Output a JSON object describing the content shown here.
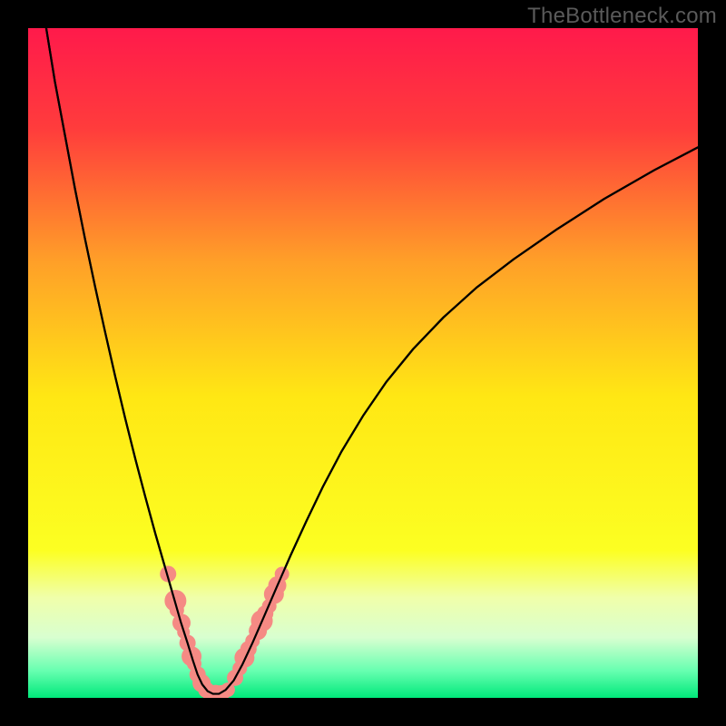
{
  "watermark": "TheBottleneck.com",
  "chart_data": {
    "type": "line",
    "title": "",
    "xlabel": "",
    "ylabel": "",
    "xlim": [
      0,
      1
    ],
    "ylim": [
      0,
      1
    ],
    "background_gradient": {
      "stops": [
        {
          "offset": 0.0,
          "color": "#ff1a4b"
        },
        {
          "offset": 0.15,
          "color": "#ff3c3c"
        },
        {
          "offset": 0.35,
          "color": "#ffa028"
        },
        {
          "offset": 0.55,
          "color": "#ffe714"
        },
        {
          "offset": 0.78,
          "color": "#fcff22"
        },
        {
          "offset": 0.85,
          "color": "#f0ffaa"
        },
        {
          "offset": 0.91,
          "color": "#d8ffd0"
        },
        {
          "offset": 0.96,
          "color": "#66ffb0"
        },
        {
          "offset": 1.0,
          "color": "#00e87a"
        }
      ]
    },
    "series": [
      {
        "name": "bottleneck-curve",
        "color": "#000000",
        "x": [
          0.027,
          0.04,
          0.055,
          0.07,
          0.085,
          0.1,
          0.115,
          0.13,
          0.145,
          0.16,
          0.175,
          0.19,
          0.205,
          0.218,
          0.228,
          0.238,
          0.246,
          0.253,
          0.26,
          0.268,
          0.276,
          0.285,
          0.295,
          0.307,
          0.32,
          0.335,
          0.352,
          0.371,
          0.392,
          0.415,
          0.44,
          0.468,
          0.5,
          0.535,
          0.575,
          0.62,
          0.67,
          0.725,
          0.79,
          0.86,
          0.935,
          1.0
        ],
        "y": [
          1.0,
          0.92,
          0.84,
          0.76,
          0.685,
          0.614,
          0.546,
          0.48,
          0.417,
          0.357,
          0.3,
          0.245,
          0.193,
          0.148,
          0.113,
          0.082,
          0.056,
          0.035,
          0.02,
          0.01,
          0.006,
          0.006,
          0.012,
          0.026,
          0.05,
          0.082,
          0.121,
          0.165,
          0.213,
          0.263,
          0.315,
          0.368,
          0.421,
          0.472,
          0.521,
          0.568,
          0.613,
          0.655,
          0.7,
          0.745,
          0.788,
          0.822
        ]
      }
    ],
    "markers": [
      {
        "name": "left-cluster",
        "color": "#f58a84",
        "points": [
          {
            "x": 0.209,
            "y": 0.185,
            "r": 9
          },
          {
            "x": 0.22,
            "y": 0.145,
            "r": 12
          },
          {
            "x": 0.222,
            "y": 0.131,
            "r": 8
          },
          {
            "x": 0.229,
            "y": 0.112,
            "r": 10
          },
          {
            "x": 0.232,
            "y": 0.098,
            "r": 7
          },
          {
            "x": 0.238,
            "y": 0.082,
            "r": 9
          },
          {
            "x": 0.244,
            "y": 0.062,
            "r": 11
          },
          {
            "x": 0.248,
            "y": 0.051,
            "r": 8
          },
          {
            "x": 0.253,
            "y": 0.035,
            "r": 9
          },
          {
            "x": 0.259,
            "y": 0.022,
            "r": 10
          },
          {
            "x": 0.266,
            "y": 0.012,
            "r": 9
          }
        ]
      },
      {
        "name": "bottom-cluster",
        "color": "#f58a84",
        "points": [
          {
            "x": 0.272,
            "y": 0.007,
            "r": 9
          },
          {
            "x": 0.28,
            "y": 0.006,
            "r": 10
          },
          {
            "x": 0.289,
            "y": 0.007,
            "r": 9
          },
          {
            "x": 0.298,
            "y": 0.012,
            "r": 8
          }
        ]
      },
      {
        "name": "right-cluster",
        "color": "#f58a84",
        "points": [
          {
            "x": 0.309,
            "y": 0.03,
            "r": 9
          },
          {
            "x": 0.316,
            "y": 0.044,
            "r": 8
          },
          {
            "x": 0.323,
            "y": 0.06,
            "r": 11
          },
          {
            "x": 0.329,
            "y": 0.073,
            "r": 9
          },
          {
            "x": 0.335,
            "y": 0.085,
            "r": 8
          },
          {
            "x": 0.343,
            "y": 0.1,
            "r": 10
          },
          {
            "x": 0.349,
            "y": 0.115,
            "r": 12
          },
          {
            "x": 0.354,
            "y": 0.126,
            "r": 9
          },
          {
            "x": 0.36,
            "y": 0.137,
            "r": 8
          },
          {
            "x": 0.367,
            "y": 0.155,
            "r": 11
          },
          {
            "x": 0.372,
            "y": 0.168,
            "r": 10
          },
          {
            "x": 0.379,
            "y": 0.185,
            "r": 8
          }
        ]
      }
    ]
  }
}
